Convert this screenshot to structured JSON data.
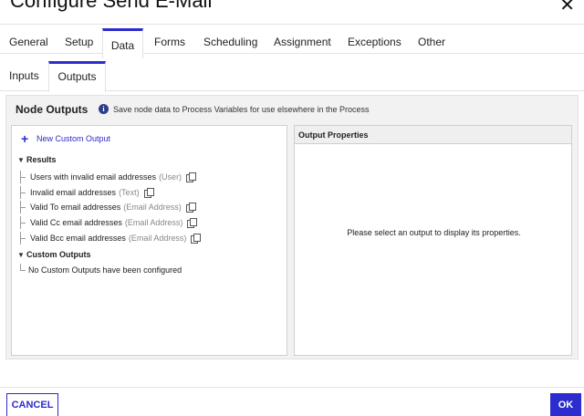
{
  "dialog": {
    "title": "Configure Send E-Mail",
    "close_icon": "close-icon"
  },
  "primary_tabs": [
    {
      "label": "General"
    },
    {
      "label": "Setup"
    },
    {
      "label": "Data",
      "active": true
    },
    {
      "label": "Forms"
    },
    {
      "label": "Scheduling"
    },
    {
      "label": "Assignment"
    },
    {
      "label": "Exceptions"
    },
    {
      "label": "Other"
    }
  ],
  "secondary_tabs": [
    {
      "label": "Inputs"
    },
    {
      "label": "Outputs",
      "active": true
    }
  ],
  "panel": {
    "title": "Node Outputs",
    "info_icon": "info-icon",
    "info_text": "Save node data to Process Variables for use elsewhere in the Process"
  },
  "outputs": {
    "new_output_label": "New Custom Output",
    "groups": {
      "results": {
        "label": "Results",
        "items": [
          {
            "name": "Users with invalid email addresses",
            "type": "(User)"
          },
          {
            "name": "Invalid email addresses",
            "type": "(Text)"
          },
          {
            "name": "Valid To email addresses",
            "type": "(Email Address)"
          },
          {
            "name": "Valid Cc email addresses",
            "type": "(Email Address)"
          },
          {
            "name": "Valid Bcc email addresses",
            "type": "(Email Address)"
          }
        ]
      },
      "custom": {
        "label": "Custom Outputs",
        "empty_message": "No Custom Outputs have been configured"
      }
    }
  },
  "properties": {
    "header": "Output Properties",
    "placeholder": "Please select an output to display its properties."
  },
  "footer": {
    "cancel_label": "CANCEL",
    "ok_label": "OK"
  },
  "colors": {
    "accent": "#2c2ccf",
    "panel_bg": "#f2f2f2",
    "type_text": "#888888"
  }
}
